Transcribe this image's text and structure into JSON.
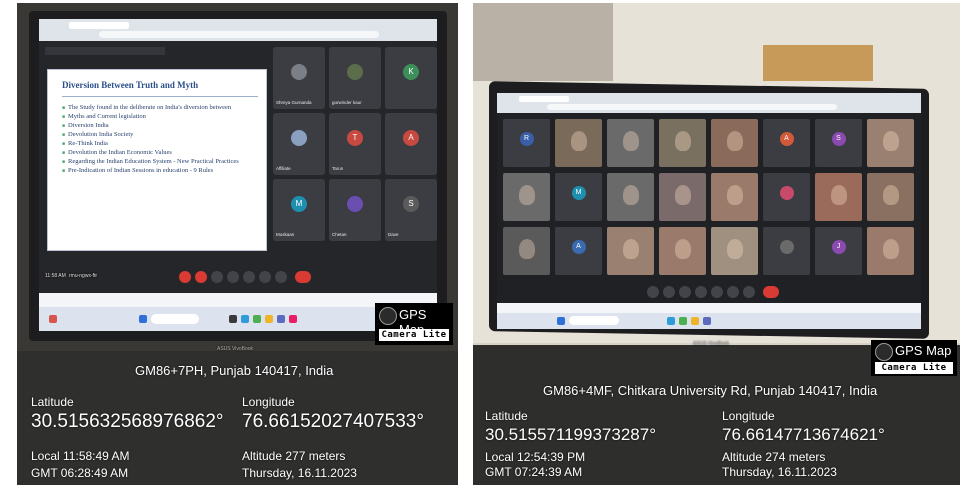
{
  "left": {
    "slide": {
      "title": "Diversion Between Truth and Myth",
      "lines": [
        "The Study found in the deliberate on India's diversion between",
        "Myths and Current legislation",
        "Diversion India",
        "Devolution India Society",
        "Re-Think India",
        "Devolution the Indian Economic Values",
        "Regarding the Indian Education System - New Practical Practices",
        "Pre-Indication of Indian Sessions in education - 9 Rules"
      ]
    },
    "tiles": [
      {
        "name": "Shreya Gurnanda",
        "initial": "",
        "color": "#7a7f88"
      },
      {
        "name": "gurwinder kaur",
        "initial": "",
        "color": "#5b6d4a"
      },
      {
        "name": "",
        "initial": "K",
        "color": "#3c8f5a"
      },
      {
        "name": "Affiliate",
        "initial": "",
        "color": "#8aa0c0"
      },
      {
        "name": "Tarun",
        "initial": "T",
        "color": "#c8493f"
      },
      {
        "name": "",
        "initial": "A",
        "color": "#c8493f"
      },
      {
        "name": "Muskaan",
        "initial": "M",
        "color": "#1f8fb0"
      },
      {
        "name": "Chetan",
        "initial": "",
        "color": "#6a4fb0"
      },
      {
        "name": "Dave",
        "initial": "S",
        "color": "#5b5b5b"
      }
    ],
    "meeting_bar_time": "11:58 AM",
    "meeting_code": "rmu-ngwx-ftr",
    "address": "GM86+7PH, Punjab 140417, India",
    "latitude_label": "Latitude",
    "latitude": "30.515632568976862°",
    "longitude_label": "Longitude",
    "longitude": "76.66152027407533°",
    "local_time": "Local 11:58:49 AM",
    "gmt_time": "GMT 06:28:49 AM",
    "altitude": "Altitude 277 meters",
    "date": "Thursday, 16.11.2023"
  },
  "right": {
    "tiles": [
      {
        "initial": "R",
        "color": "#3a5ea8",
        "photo": false
      },
      {
        "initial": "",
        "color": "#7a6a5a",
        "photo": true
      },
      {
        "initial": "",
        "color": "#6a6a6a",
        "photo": true
      },
      {
        "initial": "",
        "color": "#7a7060",
        "photo": true
      },
      {
        "initial": "",
        "color": "#8a6a5a",
        "photo": true
      },
      {
        "initial": "A",
        "color": "#d25a3a",
        "photo": false
      },
      {
        "initial": "S",
        "color": "#8a4ab0",
        "photo": false
      },
      {
        "initial": "",
        "color": "#9a8070",
        "photo": true
      },
      {
        "initial": "",
        "color": "#6a6a6a",
        "photo": true
      },
      {
        "initial": "M",
        "color": "#1f8fb0",
        "photo": false
      },
      {
        "initial": "",
        "color": "#6a6a6a",
        "photo": true
      },
      {
        "initial": "",
        "color": "#7a6a6a",
        "photo": true
      },
      {
        "initial": "",
        "color": "#9a7a6a",
        "photo": true
      },
      {
        "initial": "",
        "color": "#c84a6a",
        "photo": false
      },
      {
        "initial": "",
        "color": "#9a6a5a",
        "photo": true
      },
      {
        "initial": "",
        "color": "#8a7060",
        "photo": true
      },
      {
        "initial": "",
        "color": "#5a5a5a",
        "photo": true
      },
      {
        "initial": "A",
        "color": "#3a6ab0",
        "photo": false
      },
      {
        "initial": "",
        "color": "#9a8070",
        "photo": true
      },
      {
        "initial": "",
        "color": "#9a7a6a",
        "photo": true
      },
      {
        "initial": "",
        "color": "#a09080",
        "photo": true
      },
      {
        "initial": "",
        "color": "#6a6a6a",
        "photo": false
      },
      {
        "initial": "J",
        "color": "#8a4ab0",
        "photo": false
      },
      {
        "initial": "",
        "color": "#9a7a6a",
        "photo": true
      }
    ],
    "address": "GM86+4MF, Chitkara University Rd, Punjab 140417, India",
    "latitude_label": "Latitude",
    "latitude": "30.515571199373287°",
    "longitude_label": "Longitude",
    "longitude": "76.66147713674621°",
    "local_time": "Local 12:54:39 PM",
    "gmt_time": "GMT 07:24:39 AM",
    "altitude": "Altitude 274 meters",
    "date": "Thursday, 16.11.2023"
  },
  "badge": {
    "title": "GPS Map",
    "subtitle": "Camera Lite"
  },
  "laptop_brand": "ASUS VivoBook"
}
